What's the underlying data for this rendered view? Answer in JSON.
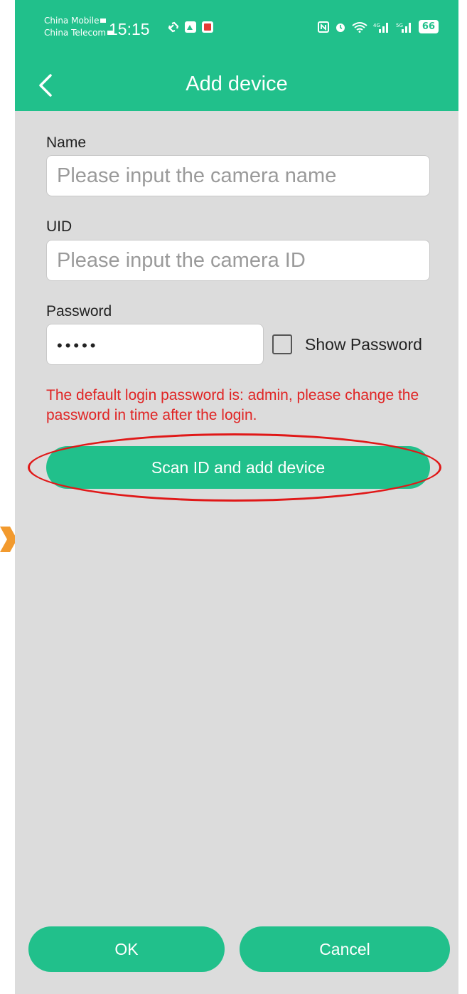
{
  "status_bar": {
    "carrier_1": "China Mobile",
    "carrier_2": "China Telecom",
    "time": "15:15",
    "battery": "66"
  },
  "header": {
    "title": "Add device"
  },
  "form": {
    "name": {
      "label": "Name",
      "placeholder": "Please input the camera name"
    },
    "uid": {
      "label": "UID",
      "placeholder": "Please input the camera ID"
    },
    "password": {
      "label": "Password",
      "value_masked": "•••••"
    },
    "show_password": {
      "label": "Show Password",
      "checked": false
    }
  },
  "warning_text": "The default login password is: admin, please change the password in time after the login.",
  "scan_button": "Scan ID and add device",
  "footer": {
    "ok_label": "OK",
    "cancel_label": "Cancel"
  },
  "colors": {
    "accent": "#21c08b",
    "background": "#dcdcdc",
    "warning": "#e02424",
    "highlight": "#e01818"
  }
}
